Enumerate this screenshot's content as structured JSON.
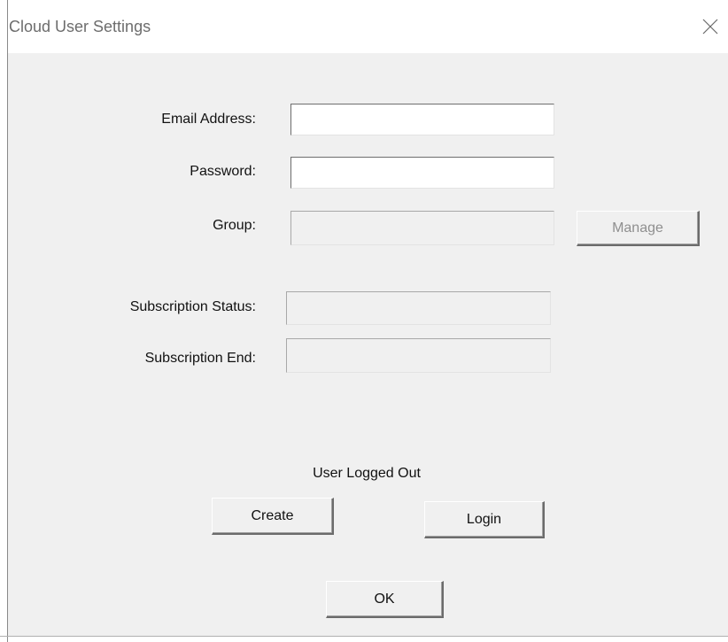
{
  "window": {
    "title": "Cloud User Settings"
  },
  "form": {
    "email_label": "Email Address:",
    "email_value": "",
    "password_label": "Password:",
    "password_value": "",
    "group_label": "Group:",
    "group_value": "",
    "manage_label": "Manage",
    "subscription_status_label": "Subscription Status:",
    "subscription_status_value": "",
    "subscription_end_label": "Subscription End:",
    "subscription_end_value": ""
  },
  "status": {
    "text": "User Logged Out"
  },
  "actions": {
    "create_label": "Create",
    "login_label": "Login",
    "ok_label": "OK"
  },
  "icons": {
    "close": "close-icon"
  }
}
